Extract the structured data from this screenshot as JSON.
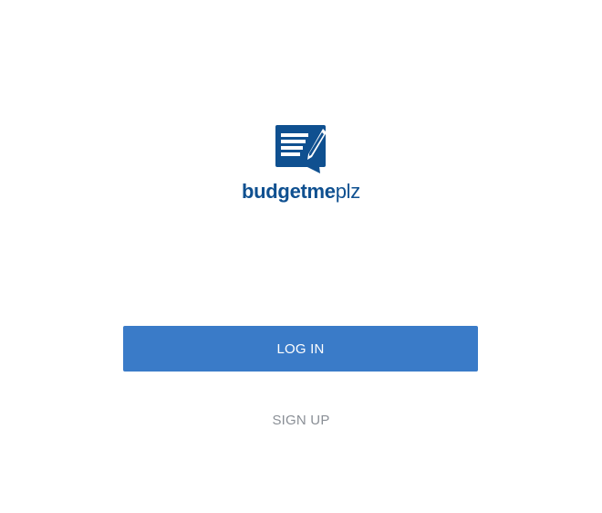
{
  "brand": {
    "name_bold": "budgetme",
    "name_light": "plz",
    "icon": "notepad-pen-icon",
    "color": "#0f5090"
  },
  "actions": {
    "login_label": "LOG IN",
    "signup_label": "SIGN UP"
  },
  "colors": {
    "login_background": "#3a7bc8",
    "signup_text": "#8a8f96",
    "page_background": "#ffffff"
  }
}
